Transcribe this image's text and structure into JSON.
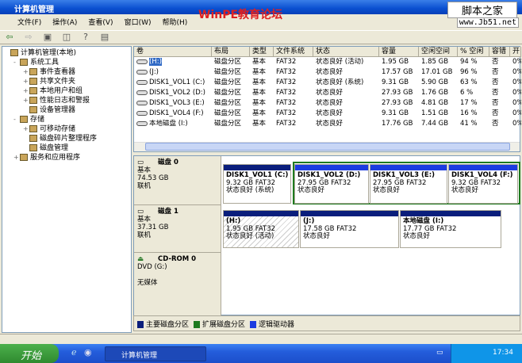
{
  "window": {
    "title": "计算机管理",
    "watermark": "WinPE教育论坛",
    "site_logo": "脚本之家",
    "site_url": "www.Jb51.net"
  },
  "menu": [
    "文件(F)",
    "操作(A)",
    "查看(V)",
    "窗口(W)",
    "帮助(H)"
  ],
  "tree": [
    {
      "label": "计算机管理(本地)",
      "level": 0,
      "expander": ""
    },
    {
      "label": "系统工具",
      "level": 1,
      "expander": "-"
    },
    {
      "label": "事件查看器",
      "level": 2,
      "expander": "+"
    },
    {
      "label": "共享文件夹",
      "level": 2,
      "expander": "+"
    },
    {
      "label": "本地用户和组",
      "level": 2,
      "expander": "+"
    },
    {
      "label": "性能日志和警报",
      "level": 2,
      "expander": "+"
    },
    {
      "label": "设备管理器",
      "level": 2,
      "expander": ""
    },
    {
      "label": "存储",
      "level": 1,
      "expander": "-"
    },
    {
      "label": "可移动存储",
      "level": 2,
      "expander": "+"
    },
    {
      "label": "磁盘碎片整理程序",
      "level": 2,
      "expander": ""
    },
    {
      "label": "磁盘管理",
      "level": 2,
      "expander": ""
    },
    {
      "label": "服务和应用程序",
      "level": 1,
      "expander": "+"
    }
  ],
  "columns": [
    "卷",
    "布局",
    "类型",
    "文件系统",
    "状态",
    "容量",
    "空闲空间",
    "% 空闲",
    "容错",
    "开"
  ],
  "volumes": [
    [
      "(H:)",
      "磁盘分区",
      "基本",
      "FAT32",
      "状态良好 (活动)",
      "1.95 GB",
      "1.85 GB",
      "94 %",
      "否",
      "0%"
    ],
    [
      "(J:)",
      "磁盘分区",
      "基本",
      "FAT32",
      "状态良好",
      "17.57 GB",
      "17.01 GB",
      "96 %",
      "否",
      "0%"
    ],
    [
      "DISK1_VOL1 (C:)",
      "磁盘分区",
      "基本",
      "FAT32",
      "状态良好 (系统)",
      "9.31 GB",
      "5.90 GB",
      "63 %",
      "否",
      "0%"
    ],
    [
      "DISK1_VOL2 (D:)",
      "磁盘分区",
      "基本",
      "FAT32",
      "状态良好",
      "27.93 GB",
      "1.76 GB",
      "6 %",
      "否",
      "0%"
    ],
    [
      "DISK1_VOL3 (E:)",
      "磁盘分区",
      "基本",
      "FAT32",
      "状态良好",
      "27.93 GB",
      "4.81 GB",
      "17 %",
      "否",
      "0%"
    ],
    [
      "DISK1_VOL4 (F:)",
      "磁盘分区",
      "基本",
      "FAT32",
      "状态良好",
      "9.31 GB",
      "1.51 GB",
      "16 %",
      "否",
      "0%"
    ],
    [
      "本地磁盘 (I:)",
      "磁盘分区",
      "基本",
      "FAT32",
      "状态良好",
      "17.76 GB",
      "7.44 GB",
      "41 %",
      "否",
      "0%"
    ]
  ],
  "disks": [
    {
      "name": "磁盘 0",
      "type": "基本",
      "size": "74.53 GB",
      "state": "联机",
      "partitions": [
        {
          "name": "DISK1_VOL1 (C:)",
          "size": "9.32 GB FAT32",
          "status": "状态良好 (系统)"
        },
        {
          "name": "DISK1_VOL2 (D:)",
          "size": "27.95 GB FAT32",
          "status": "状态良好"
        },
        {
          "name": "DISK1_VOL3 (E:)",
          "size": "27.95 GB FAT32",
          "status": "状态良好"
        },
        {
          "name": "DISK1_VOL4 (F:)",
          "size": "9.32 GB FAT32",
          "status": "状态良好"
        }
      ]
    },
    {
      "name": "磁盘 1",
      "type": "基本",
      "size": "37.31 GB",
      "state": "联机",
      "partitions": [
        {
          "name": "(H:)",
          "size": "1.95 GB FAT32",
          "status": "状态良好 (活动)"
        },
        {
          "name": "(J:)",
          "size": "17.58 GB FAT32",
          "status": "状态良好"
        },
        {
          "name": "本地磁盘 (I:)",
          "size": "17.77 GB FAT32",
          "status": "状态良好"
        }
      ]
    },
    {
      "name": "CD-ROM 0",
      "type": "DVD (G:)",
      "state": "无媒体"
    }
  ],
  "legend": [
    {
      "label": "主要磁盘分区",
      "color": "#0a1e7c"
    },
    {
      "label": "扩展磁盘分区",
      "color": "#1e7a1e"
    },
    {
      "label": "逻辑驱动器",
      "color": "#1c3ce0"
    }
  ],
  "taskbar": {
    "start": "开始",
    "task": "计算机管理",
    "clock": "17:34"
  }
}
